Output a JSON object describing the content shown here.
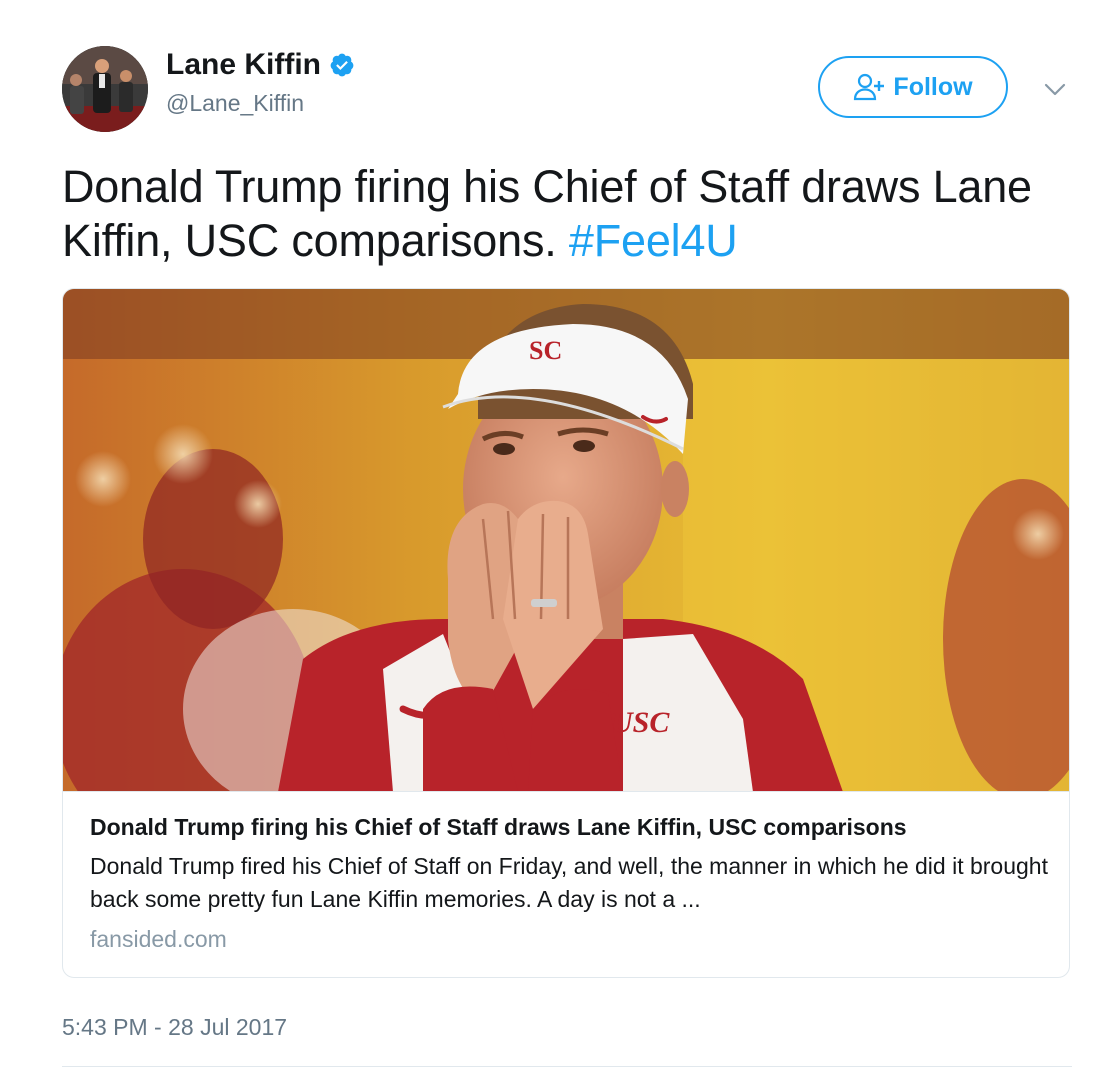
{
  "author": {
    "display_name": "Lane Kiffin",
    "handle": "@Lane_Kiffin",
    "verified": true
  },
  "actions": {
    "follow_label": "Follow"
  },
  "tweet": {
    "text": "Donald Trump firing his Chief of Staff draws Lane Kiffin, USC comparisons.",
    "hashtag": "#Feel4U"
  },
  "card": {
    "title": "Donald Trump firing his Chief of Staff draws Lane Kiffin, USC comparisons",
    "description": "Donald Trump fired his Chief of Staff on Friday, and well, the manner in which he did it brought back some pretty fun Lane Kiffin memories. A day is not a ...",
    "domain": "fansided.com",
    "image_text": {
      "visor_logo": "SC",
      "jacket_logo": "USC"
    }
  },
  "timestamp": "5:43 PM - 28 Jul 2017",
  "icons": {
    "verified": "verified-badge-icon",
    "follow": "add-user-icon",
    "menu": "chevron-down-icon"
  },
  "colors": {
    "accent": "#1da1f2",
    "text": "#14171a",
    "secondary": "#657786",
    "border": "#e1e8ed",
    "usc_cardinal": "#b8232a",
    "background_gold": "#e6b422"
  }
}
